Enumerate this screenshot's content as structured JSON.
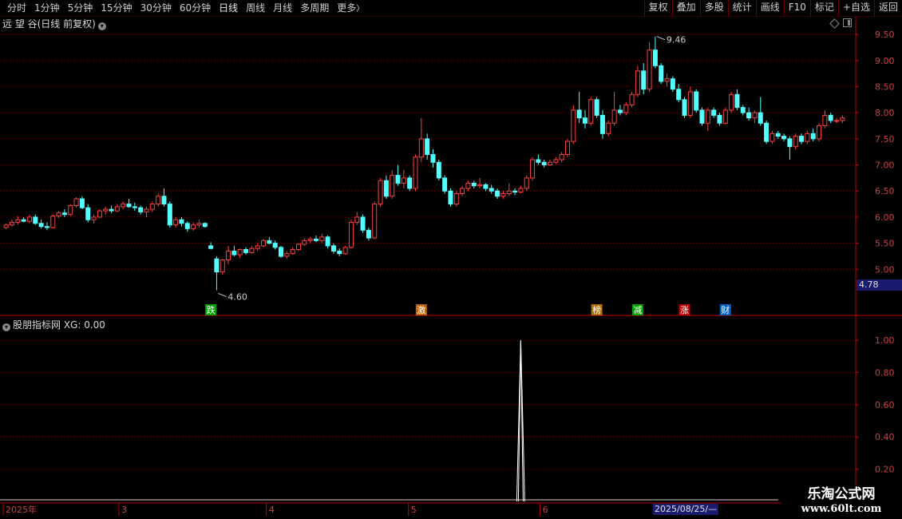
{
  "toolbar": {
    "periods": [
      "分时",
      "1分钟",
      "5分钟",
      "15分钟",
      "30分钟",
      "60分钟",
      "日线",
      "周线",
      "月线",
      "多周期",
      "更多"
    ],
    "more_arrow": "〉",
    "buttons": [
      "复权",
      "叠加",
      "多股",
      "统计",
      "画线",
      "F10",
      "标记",
      "+自选",
      "返回"
    ]
  },
  "stock": {
    "title": "远 望 谷(日线 前复权)"
  },
  "indicator": {
    "title": "股朋指标网 XG: 0.00"
  },
  "price_axis": {
    "labels": [
      "9.50",
      "9.00",
      "8.50",
      "8.00",
      "7.50",
      "7.00",
      "6.50",
      "6.00",
      "5.50",
      "5.00"
    ],
    "current_value": "4.78"
  },
  "indicator_axis": {
    "labels": [
      "1.00",
      "0.80",
      "0.60",
      "0.40",
      "0.20"
    ]
  },
  "time_axis": {
    "labels": [
      "2025年",
      "3",
      "4",
      "5",
      "6",
      "7",
      "8"
    ],
    "cursor_date": "2025/08/25/—"
  },
  "annotations": {
    "high": "9.46",
    "low": "4.60"
  },
  "event_markers": [
    {
      "label": "跌",
      "color": "#00a000",
      "text_color": "#ffffff"
    },
    {
      "label": "激",
      "color": "#c06000",
      "text_color": "#ffffff"
    },
    {
      "label": "榜",
      "color": "#b07000",
      "text_color": "#ffffff"
    },
    {
      "label": "减",
      "color": "#00a000",
      "text_color": "#ffffff"
    },
    {
      "label": "涨",
      "color": "#c00000",
      "text_color": "#ffffff"
    },
    {
      "label": "财",
      "color": "#0060c0",
      "text_color": "#ffffff"
    }
  ],
  "watermark": {
    "line1": "乐淘公式网",
    "line2": "www.60lt.com"
  },
  "colors": {
    "up": "#ff4040",
    "down": "#54ffff",
    "grid": "#800000",
    "axis": "#c00000"
  },
  "chart_data": [
    {
      "type": "candlestick",
      "title": "远 望 谷(日线 前复权)",
      "ylim": [
        4.5,
        9.7
      ],
      "ohlc": [
        [
          5.8,
          5.88,
          5.77,
          5.85
        ],
        [
          5.85,
          5.95,
          5.82,
          5.9
        ],
        [
          5.9,
          6.02,
          5.86,
          5.95
        ],
        [
          5.95,
          6.0,
          5.9,
          5.92
        ],
        [
          5.92,
          6.05,
          5.88,
          6.0
        ],
        [
          6.0,
          6.05,
          5.85,
          5.88
        ],
        [
          5.88,
          5.95,
          5.78,
          5.82
        ],
        [
          5.82,
          5.9,
          5.75,
          5.8
        ],
        [
          5.8,
          6.05,
          5.78,
          6.02
        ],
        [
          6.02,
          6.12,
          5.98,
          6.08
        ],
        [
          6.08,
          6.15,
          6.0,
          6.05
        ],
        [
          6.05,
          6.25,
          6.02,
          6.22
        ],
        [
          6.22,
          6.38,
          6.18,
          6.35
        ],
        [
          6.35,
          6.4,
          6.15,
          6.18
        ],
        [
          6.18,
          6.25,
          5.9,
          5.95
        ],
        [
          5.95,
          6.05,
          5.88,
          6.0
        ],
        [
          6.0,
          6.15,
          5.98,
          6.12
        ],
        [
          6.12,
          6.2,
          6.05,
          6.15
        ],
        [
          6.15,
          6.22,
          6.08,
          6.12
        ],
        [
          6.12,
          6.25,
          6.1,
          6.2
        ],
        [
          6.2,
          6.3,
          6.15,
          6.25
        ],
        [
          6.25,
          6.35,
          6.18,
          6.2
        ],
        [
          6.2,
          6.28,
          6.12,
          6.18
        ],
        [
          6.18,
          6.22,
          6.05,
          6.1
        ],
        [
          6.1,
          6.2,
          6.0,
          6.15
        ],
        [
          6.15,
          6.3,
          6.1,
          6.25
        ],
        [
          6.25,
          6.45,
          6.2,
          6.4
        ],
        [
          6.4,
          6.55,
          6.2,
          6.25
        ],
        [
          6.25,
          6.3,
          5.8,
          5.85
        ],
        [
          5.85,
          6.0,
          5.8,
          5.95
        ],
        [
          5.95,
          6.0,
          5.82,
          5.88
        ],
        [
          5.88,
          5.92,
          5.72,
          5.78
        ],
        [
          5.78,
          5.9,
          5.74,
          5.85
        ],
        [
          5.85,
          5.95,
          5.8,
          5.88
        ],
        [
          5.88,
          5.9,
          5.8,
          5.82
        ],
        [
          5.45,
          5.52,
          5.38,
          5.4
        ],
        [
          5.2,
          5.25,
          4.6,
          4.95
        ],
        [
          4.95,
          5.2,
          4.9,
          5.18
        ],
        [
          5.18,
          5.45,
          5.1,
          5.35
        ],
        [
          5.35,
          5.45,
          5.25,
          5.28
        ],
        [
          5.28,
          5.4,
          5.22,
          5.38
        ],
        [
          5.38,
          5.42,
          5.28,
          5.32
        ],
        [
          5.32,
          5.45,
          5.3,
          5.4
        ],
        [
          5.4,
          5.5,
          5.35,
          5.45
        ],
        [
          5.45,
          5.58,
          5.42,
          5.55
        ],
        [
          5.55,
          5.62,
          5.48,
          5.5
        ],
        [
          5.5,
          5.55,
          5.38,
          5.42
        ],
        [
          5.42,
          5.45,
          5.22,
          5.25
        ],
        [
          5.25,
          5.35,
          5.2,
          5.3
        ],
        [
          5.3,
          5.42,
          5.28,
          5.38
        ],
        [
          5.38,
          5.5,
          5.35,
          5.48
        ],
        [
          5.48,
          5.6,
          5.45,
          5.55
        ],
        [
          5.55,
          5.62,
          5.5,
          5.58
        ],
        [
          5.58,
          5.65,
          5.52,
          5.55
        ],
        [
          5.55,
          5.68,
          5.5,
          5.62
        ],
        [
          5.62,
          5.65,
          5.4,
          5.45
        ],
        [
          5.45,
          5.5,
          5.3,
          5.35
        ],
        [
          5.35,
          5.4,
          5.25,
          5.3
        ],
        [
          5.3,
          5.45,
          5.28,
          5.42
        ],
        [
          5.42,
          5.95,
          5.4,
          5.9
        ],
        [
          5.9,
          6.1,
          5.85,
          6.0
        ],
        [
          6.0,
          6.05,
          5.7,
          5.75
        ],
        [
          5.75,
          5.8,
          5.55,
          5.6
        ],
        [
          5.6,
          6.3,
          5.58,
          6.25
        ],
        [
          6.25,
          6.75,
          6.2,
          6.7
        ],
        [
          6.7,
          6.8,
          6.35,
          6.4
        ],
        [
          6.4,
          6.9,
          6.35,
          6.8
        ],
        [
          6.8,
          7.0,
          6.6,
          6.65
        ],
        [
          6.65,
          6.9,
          6.55,
          6.75
        ],
        [
          6.75,
          6.8,
          6.5,
          6.55
        ],
        [
          6.55,
          7.2,
          6.5,
          7.15
        ],
        [
          7.15,
          7.9,
          7.05,
          7.5
        ],
        [
          7.5,
          7.6,
          7.1,
          7.2
        ],
        [
          7.2,
          7.3,
          6.95,
          7.05
        ],
        [
          7.05,
          7.1,
          6.7,
          6.75
        ],
        [
          6.75,
          6.8,
          6.45,
          6.5
        ],
        [
          6.5,
          6.55,
          6.2,
          6.25
        ],
        [
          6.25,
          6.5,
          6.2,
          6.45
        ],
        [
          6.45,
          6.6,
          6.4,
          6.55
        ],
        [
          6.55,
          6.7,
          6.5,
          6.65
        ],
        [
          6.65,
          6.7,
          6.55,
          6.6
        ],
        [
          6.6,
          6.75,
          6.55,
          6.62
        ],
        [
          6.62,
          6.65,
          6.5,
          6.55
        ],
        [
          6.55,
          6.62,
          6.45,
          6.5
        ],
        [
          6.5,
          6.55,
          6.35,
          6.4
        ],
        [
          6.4,
          6.5,
          6.35,
          6.45
        ],
        [
          6.45,
          6.65,
          6.4,
          6.5
        ],
        [
          6.5,
          6.55,
          6.42,
          6.48
        ],
        [
          6.48,
          6.6,
          6.45,
          6.55
        ],
        [
          6.55,
          6.8,
          6.5,
          6.75
        ],
        [
          6.75,
          7.15,
          6.7,
          7.1
        ],
        [
          7.1,
          7.2,
          7.0,
          7.05
        ],
        [
          7.05,
          7.1,
          6.95,
          7.0
        ],
        [
          7.0,
          7.1,
          6.98,
          7.05
        ],
        [
          7.05,
          7.15,
          7.02,
          7.1
        ],
        [
          7.1,
          7.25,
          7.05,
          7.2
        ],
        [
          7.2,
          7.5,
          7.15,
          7.45
        ],
        [
          7.45,
          8.15,
          7.4,
          8.05
        ],
        [
          8.05,
          8.4,
          7.8,
          7.9
        ],
        [
          7.9,
          8.05,
          7.7,
          7.8
        ],
        [
          7.8,
          8.3,
          7.75,
          8.25
        ],
        [
          8.25,
          8.3,
          7.9,
          7.95
        ],
        [
          7.95,
          8.05,
          7.5,
          7.6
        ],
        [
          7.6,
          7.85,
          7.55,
          7.8
        ],
        [
          7.8,
          8.4,
          7.75,
          8.05
        ],
        [
          8.05,
          8.15,
          7.95,
          8.0
        ],
        [
          8.0,
          8.2,
          7.95,
          8.15
        ],
        [
          8.15,
          8.4,
          8.1,
          8.35
        ],
        [
          8.35,
          8.9,
          8.3,
          8.8
        ],
        [
          8.8,
          8.95,
          8.35,
          8.45
        ],
        [
          8.45,
          9.35,
          8.4,
          9.2
        ],
        [
          9.2,
          9.46,
          8.85,
          8.9
        ],
        [
          8.9,
          8.95,
          8.55,
          8.6
        ],
        [
          8.6,
          8.75,
          8.5,
          8.65
        ],
        [
          8.65,
          8.7,
          8.4,
          8.45
        ],
        [
          8.45,
          8.55,
          8.2,
          8.25
        ],
        [
          8.25,
          8.3,
          7.9,
          7.95
        ],
        [
          7.95,
          8.5,
          7.9,
          8.4
        ],
        [
          8.4,
          8.45,
          8.0,
          8.05
        ],
        [
          8.05,
          8.1,
          7.75,
          7.8
        ],
        [
          7.8,
          8.1,
          7.65,
          8.05
        ],
        [
          8.05,
          8.1,
          7.9,
          7.95
        ],
        [
          7.95,
          8.0,
          7.75,
          7.8
        ],
        [
          7.8,
          8.1,
          7.78,
          8.05
        ],
        [
          8.05,
          8.4,
          8.0,
          8.35
        ],
        [
          8.35,
          8.45,
          8.05,
          8.1
        ],
        [
          8.1,
          8.15,
          7.95,
          8.0
        ],
        [
          8.0,
          8.1,
          7.85,
          7.9
        ],
        [
          7.9,
          8.05,
          7.8,
          8.0
        ],
        [
          8.0,
          8.3,
          7.75,
          7.8
        ],
        [
          7.8,
          7.85,
          7.4,
          7.45
        ],
        [
          7.45,
          7.65,
          7.4,
          7.6
        ],
        [
          7.6,
          7.65,
          7.5,
          7.55
        ],
        [
          7.55,
          7.6,
          7.45,
          7.5
        ],
        [
          7.5,
          7.55,
          7.1,
          7.35
        ],
        [
          7.35,
          7.6,
          7.3,
          7.55
        ],
        [
          7.55,
          7.6,
          7.4,
          7.45
        ],
        [
          7.45,
          7.65,
          7.4,
          7.6
        ],
        [
          7.6,
          7.7,
          7.45,
          7.5
        ],
        [
          7.5,
          7.8,
          7.45,
          7.75
        ],
        [
          7.75,
          8.05,
          7.7,
          7.95
        ],
        [
          7.95,
          8.0,
          7.8,
          7.85
        ],
        [
          7.85,
          7.9,
          7.8,
          7.85
        ],
        [
          7.85,
          7.95,
          7.8,
          7.9
        ]
      ]
    },
    {
      "type": "line",
      "title": "股朋指标网 XG: 0.00",
      "ylim": [
        0,
        1.05
      ],
      "values": [
        0,
        0,
        0,
        0,
        0,
        0,
        0,
        0,
        0,
        0,
        0,
        0,
        0,
        0,
        0,
        0,
        0,
        0,
        0,
        0,
        0,
        0,
        0,
        0,
        0,
        0,
        0,
        0,
        0,
        0,
        0,
        0,
        0,
        0,
        0,
        0,
        0,
        0,
        0,
        0,
        0,
        0,
        0,
        0,
        0,
        0,
        0,
        0,
        0,
        0,
        0,
        0,
        0,
        0,
        0,
        0,
        0,
        0,
        0,
        0,
        0,
        0,
        0,
        0,
        0,
        0,
        0,
        0,
        0,
        0,
        0,
        0,
        0,
        0,
        0,
        0,
        0,
        0,
        0,
        0,
        0,
        0,
        0,
        0,
        0,
        0,
        0,
        0,
        0,
        0,
        0,
        0,
        0,
        0,
        0,
        0,
        0,
        0,
        0,
        0,
        0,
        0,
        0,
        0,
        0,
        0,
        0,
        0,
        0,
        0,
        0,
        0,
        0,
        0,
        0,
        0,
        0,
        0,
        0,
        0,
        0,
        0,
        0,
        0,
        0,
        0,
        0,
        0,
        0,
        0,
        0,
        0,
        0,
        0,
        0,
        0,
        0,
        0,
        0,
        0,
        0,
        0,
        0,
        0,
        0,
        0,
        0,
        0,
        0,
        0,
        0,
        0,
        0,
        0,
        0,
        0,
        0,
        0,
        0,
        0,
        0
      ],
      "spikes": [
        {
          "index": 88,
          "value": 1.0
        }
      ]
    }
  ]
}
